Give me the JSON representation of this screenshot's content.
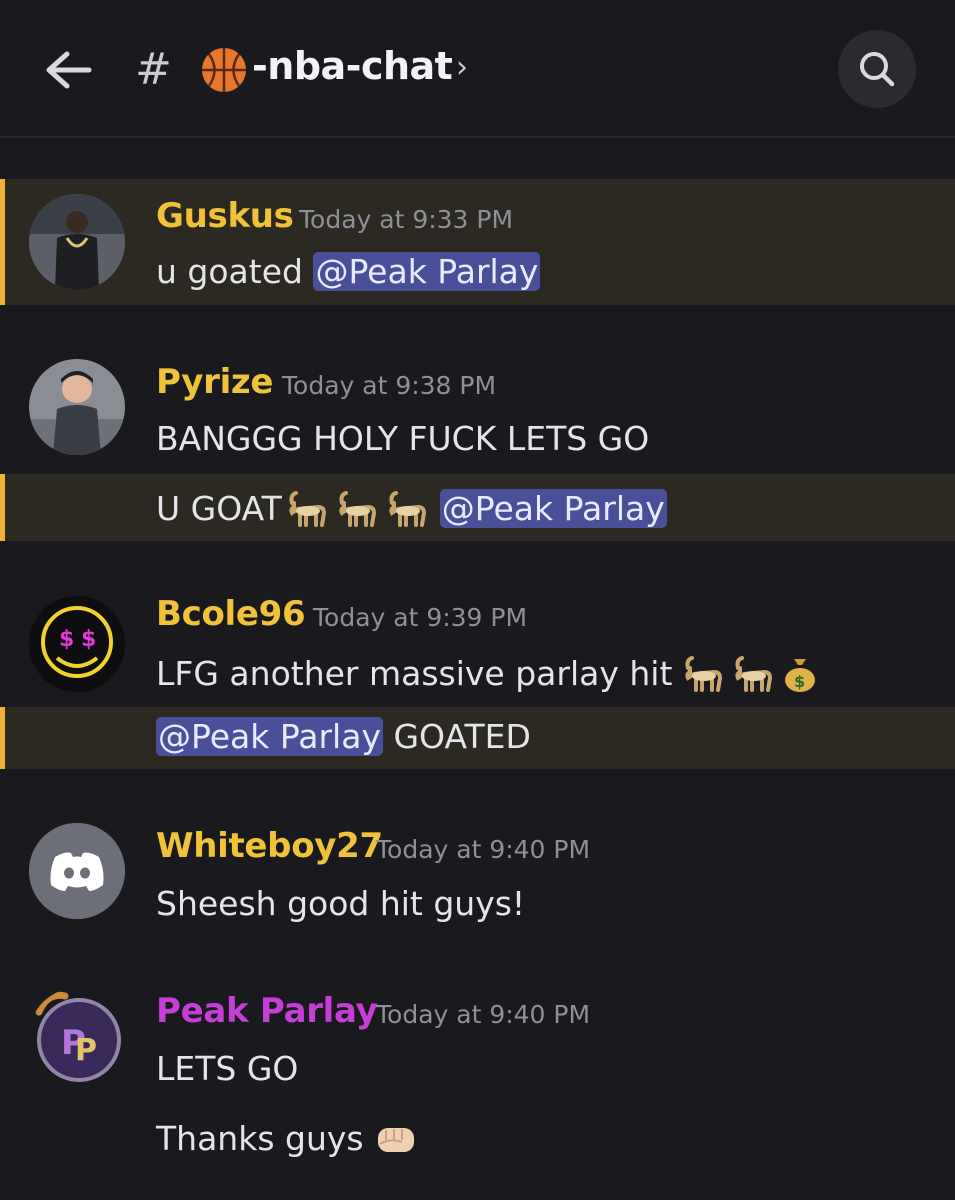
{
  "header": {
    "hash": "#",
    "channel_name": "-nba-chat",
    "chevron": "›",
    "back_icon": "arrow-left-icon",
    "search_icon": "search-icon",
    "channel_icon": "basketball-icon"
  },
  "colors": {
    "background": "#1a1a1e",
    "highlight_bg": "#2c2822",
    "highlight_bar": "#f0b232",
    "username_gold": "#f0c23a",
    "username_purple": "#c53fd6",
    "mention_bg": "#4a4f9a",
    "timestamp": "#8e9097"
  },
  "messages": [
    {
      "username": "Guskus",
      "timestamp": "Today at 9:33 PM",
      "lines": [
        {
          "text": "u goated ",
          "mention": "@Peak Parlay"
        }
      ]
    },
    {
      "username": "Pyrize",
      "timestamp": "Today at 9:38 PM",
      "lines": [
        {
          "text": "BANGGG HOLY FUCK LETS GO"
        },
        {
          "text": "U GOAT",
          "emojis": [
            "goat-emoji",
            "goat-emoji",
            "goat-emoji"
          ],
          "mention": "@Peak Parlay"
        }
      ]
    },
    {
      "username": "Bcole96",
      "timestamp": "Today at 9:39 PM",
      "lines": [
        {
          "text": "LFG another massive parlay hit",
          "emojis": [
            "goat-emoji",
            "goat-emoji",
            "money-bag-emoji"
          ]
        },
        {
          "mention": "@Peak Parlay",
          "text": " GOATED"
        }
      ]
    },
    {
      "username": "Whiteboy27",
      "timestamp": "Today at 9:40 PM",
      "lines": [
        {
          "text": "Sheesh good hit guys!"
        }
      ]
    },
    {
      "username": "Peak Parlay",
      "timestamp": "Today at 9:40 PM",
      "lines": [
        {
          "text": "LETS GO"
        },
        {
          "text": "Thanks guys",
          "emojis": [
            "fist-emoji"
          ]
        }
      ]
    }
  ]
}
